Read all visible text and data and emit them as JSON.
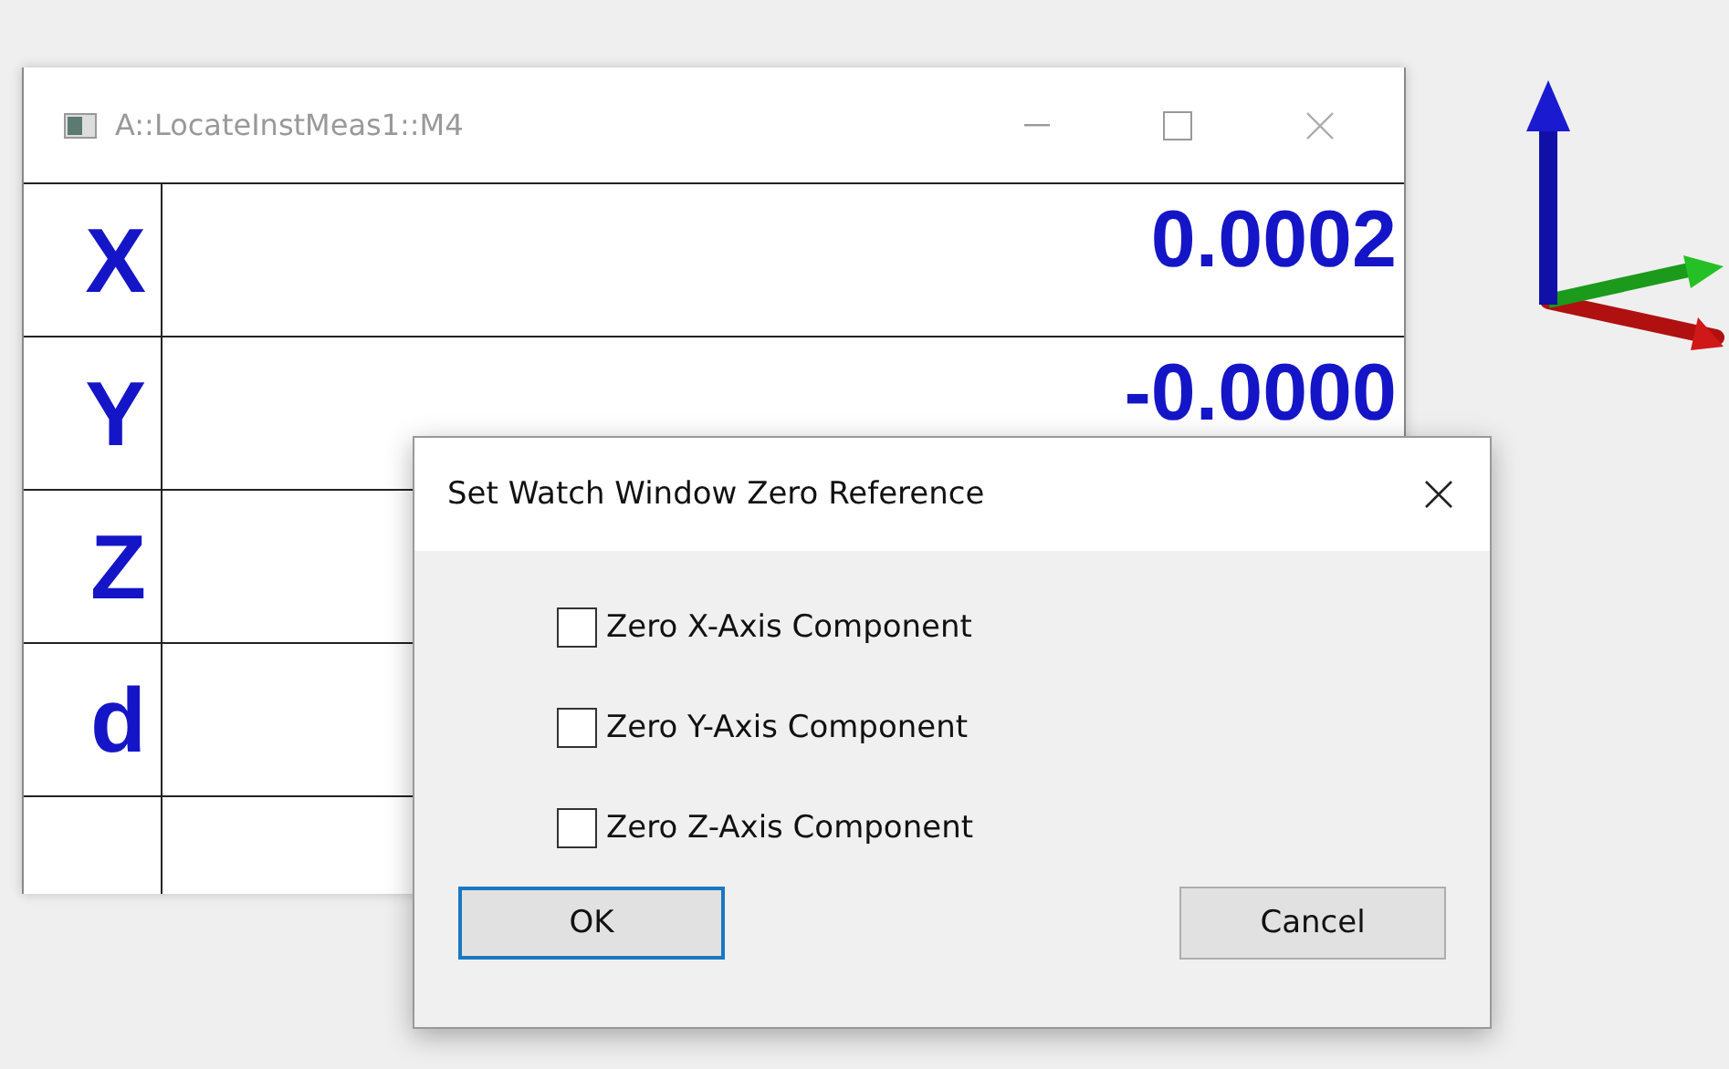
{
  "watch_window": {
    "title": "A::LocateInstMeas1::M4",
    "rows": [
      {
        "label": "X",
        "value": "0.0002"
      },
      {
        "label": "Y",
        "value": "-0.0000"
      },
      {
        "label": "Z"
      },
      {
        "label": "d"
      },
      {}
    ]
  },
  "dialog": {
    "title": "Set Watch Window Zero Reference",
    "options": [
      {
        "label": "Zero X-Axis Component",
        "checked": false
      },
      {
        "label": "Zero Y-Axis Component",
        "checked": false
      },
      {
        "label": "Zero Z-Axis Component",
        "checked": false
      }
    ],
    "buttons": [
      {
        "label": "OK",
        "kind": "default"
      },
      {
        "label": "Cancel",
        "kind": "normal"
      }
    ]
  }
}
